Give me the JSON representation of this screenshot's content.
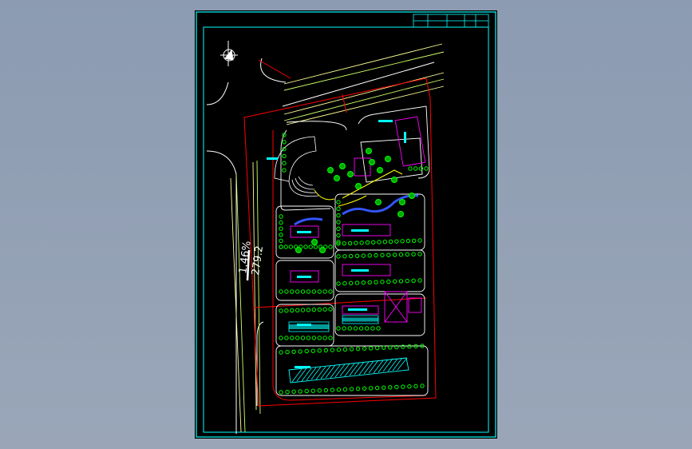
{
  "drawing": {
    "background_color": "#000000",
    "viewport_color": "#93a1b6",
    "colors": {
      "frame": "#00ffff",
      "site_boundary": "#ff0000",
      "roads": "#ffff66",
      "buildings": "#ff00ff",
      "trees": "#00ff00",
      "labels": "#00ffff",
      "water": "#3344ff",
      "paths": "#ffff00",
      "hatch": "#00ffff"
    },
    "icons": [
      "north-arrow-icon",
      "tree-symbol-icon"
    ],
    "road_annotations": {
      "grade": "1.46%",
      "length": "279.2"
    }
  }
}
